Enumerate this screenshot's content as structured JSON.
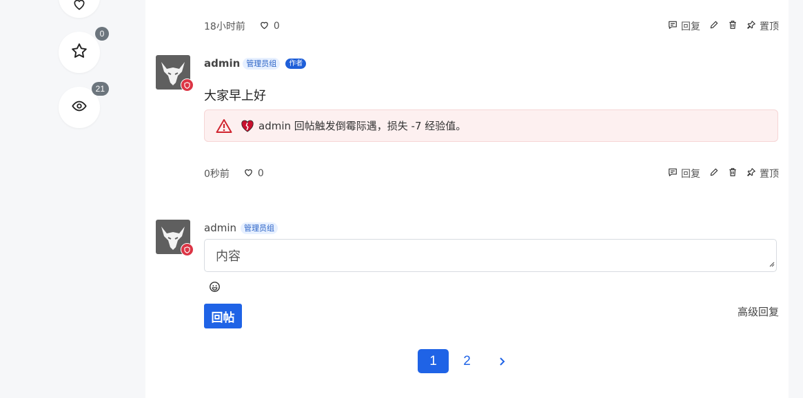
{
  "sidebar": {
    "favorite_count": "0",
    "views_count": "21"
  },
  "post1": {
    "time": "18小时前",
    "likes": "0",
    "actions": {
      "reply": "回复",
      "pin": "置顶"
    }
  },
  "post2": {
    "username": "admin",
    "group": "管理员组",
    "author_tag": "作者",
    "content": "大家早上好",
    "notice": "admin 回帖触发倒霉际遇，损失 -7 经验值。",
    "time": "0秒前",
    "likes": "0",
    "actions": {
      "reply": "回复",
      "pin": "置顶"
    }
  },
  "reply_form": {
    "username": "admin",
    "group": "管理员组",
    "placeholder": "内容",
    "submit_label": "回帖",
    "advanced_label": "高级回复"
  },
  "pagination": {
    "current": "1",
    "next_page": "2"
  },
  "colors": {
    "primary": "#1f63e6",
    "danger": "#dc3545",
    "alert_bg": "#fdf0f0"
  }
}
